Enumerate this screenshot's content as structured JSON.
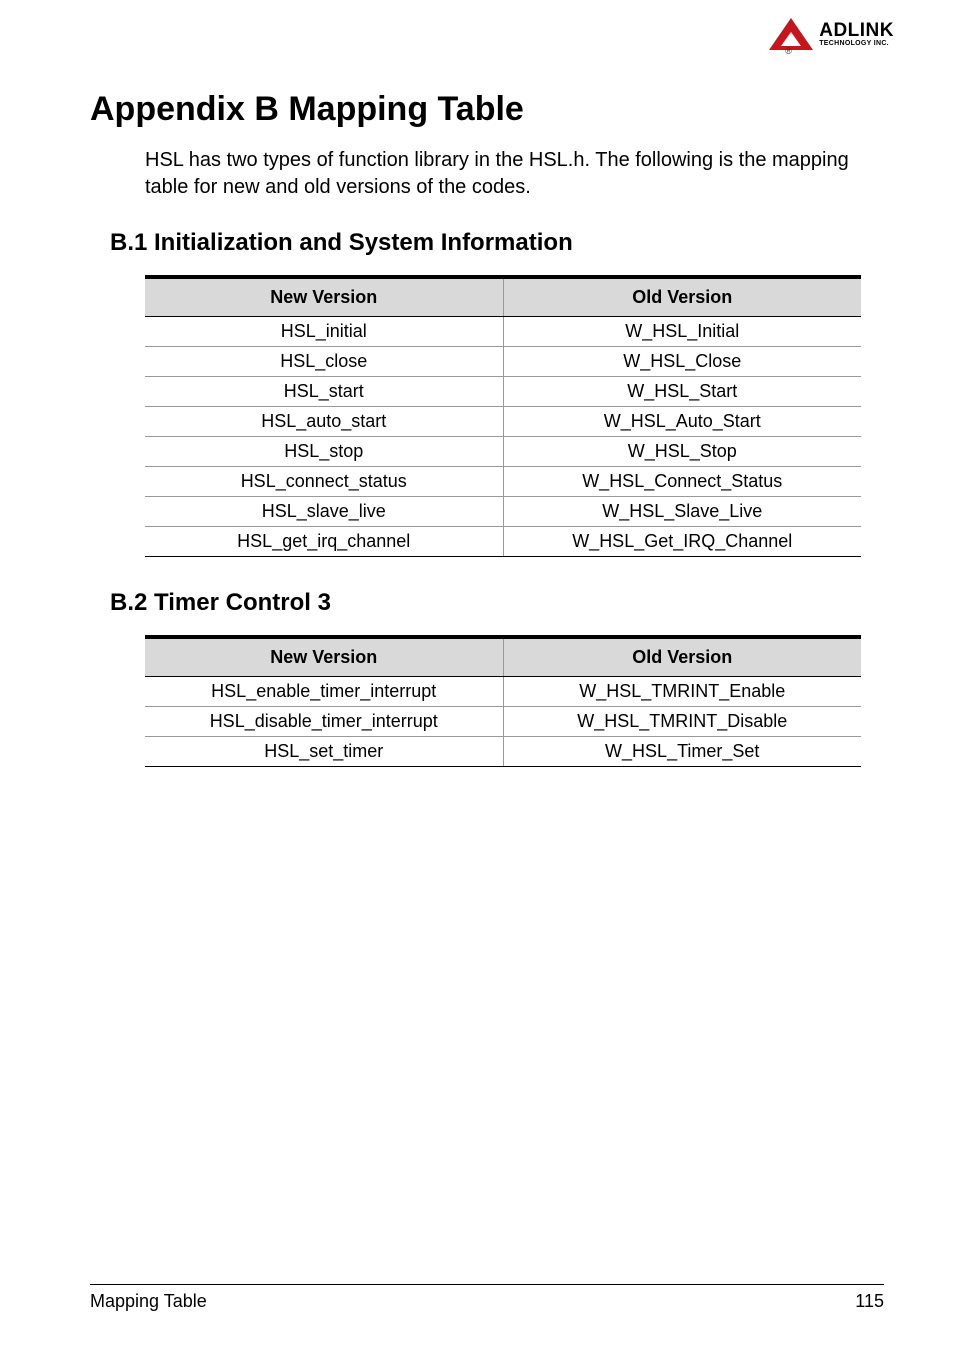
{
  "logo": {
    "main": "ADLINK",
    "sub": "TECHNOLOGY INC."
  },
  "title": "Appendix B  Mapping Table",
  "intro": "HSL has two types of function library in the HSL.h. The following is the mapping table for new and old versions of the codes.",
  "sections": [
    {
      "heading": "B.1   Initialization and System Information",
      "headers": {
        "new": "New Version",
        "old": "Old Version"
      },
      "rows": [
        {
          "new": "HSL_initial",
          "old": "W_HSL_Initial"
        },
        {
          "new": "HSL_close",
          "old": "W_HSL_Close"
        },
        {
          "new": "HSL_start",
          "old": "W_HSL_Start"
        },
        {
          "new": "HSL_auto_start",
          "old": "W_HSL_Auto_Start"
        },
        {
          "new": "HSL_stop",
          "old": "W_HSL_Stop"
        },
        {
          "new": "HSL_connect_status",
          "old": "W_HSL_Connect_Status"
        },
        {
          "new": "HSL_slave_live",
          "old": "W_HSL_Slave_Live"
        },
        {
          "new": "HSL_get_irq_channel",
          "old": "W_HSL_Get_IRQ_Channel"
        }
      ]
    },
    {
      "heading": "B.2   Timer Control 3",
      "headers": {
        "new": "New Version",
        "old": "Old Version"
      },
      "rows": [
        {
          "new": "HSL_enable_timer_interrupt",
          "old": "W_HSL_TMRINT_Enable"
        },
        {
          "new": "HSL_disable_timer_interrupt",
          "old": "W_HSL_TMRINT_Disable"
        },
        {
          "new": "HSL_set_timer",
          "old": "W_HSL_Timer_Set"
        }
      ]
    }
  ],
  "footer": {
    "left": "Mapping Table",
    "right": "115"
  }
}
